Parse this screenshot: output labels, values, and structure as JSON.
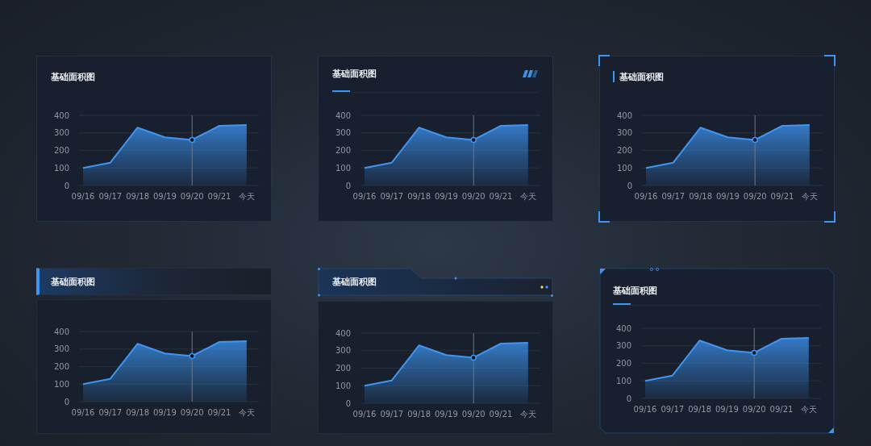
{
  "cards": [
    {
      "kind": "plain",
      "title": "基础面积图",
      "chart_data": {
        "type": "area",
        "categories": [
          "09/16",
          "09/17",
          "09/18",
          "09/19",
          "09/20",
          "09/21",
          "今天"
        ],
        "series": [
          {
            "color": "#3d96f5",
            "values": [
              100,
              130,
              330,
              275,
              260,
              340,
              345
            ]
          }
        ],
        "ylim": [
          0,
          400
        ],
        "yticks": [
          0,
          100,
          200,
          300,
          400
        ],
        "grid": true,
        "ref_lines": [
          {
            "axis": "x",
            "value": "09/20"
          }
        ]
      }
    },
    {
      "kind": "underline",
      "title": "基础面积图",
      "chart_data": {
        "type": "area",
        "categories": [
          "09/16",
          "09/17",
          "09/18",
          "09/19",
          "09/20",
          "09/21",
          "今天"
        ],
        "series": [
          {
            "color": "#3d96f5",
            "values": [
              100,
              130,
              330,
              275,
              260,
              340,
              345
            ]
          }
        ],
        "ylim": [
          0,
          400
        ],
        "yticks": [
          0,
          100,
          200,
          300,
          400
        ],
        "grid": true,
        "ref_lines": [
          {
            "axis": "x",
            "value": "09/20"
          }
        ]
      }
    },
    {
      "kind": "corners",
      "title": "基础面积图",
      "chart_data": {
        "type": "area",
        "categories": [
          "09/16",
          "09/17",
          "09/18",
          "09/19",
          "09/20",
          "09/21",
          "今天"
        ],
        "series": [
          {
            "color": "#3d96f5",
            "values": [
              100,
              130,
              330,
              275,
              260,
              340,
              345
            ]
          }
        ],
        "ylim": [
          0,
          400
        ],
        "yticks": [
          0,
          100,
          200,
          300,
          400
        ],
        "grid": true,
        "ref_lines": [
          {
            "axis": "x",
            "value": "09/20"
          }
        ]
      }
    },
    {
      "kind": "header-bar",
      "title": "基础面积图",
      "chart_data": {
        "type": "area",
        "categories": [
          "09/16",
          "09/17",
          "09/18",
          "09/19",
          "09/20",
          "09/21",
          "今天"
        ],
        "series": [
          {
            "color": "#3d96f5",
            "values": [
              100,
              130,
              330,
              275,
              260,
              340,
              345
            ]
          }
        ],
        "ylim": [
          0,
          400
        ],
        "yticks": [
          0,
          100,
          200,
          300,
          400
        ],
        "grid": true,
        "ref_lines": [
          {
            "axis": "x",
            "value": "09/20"
          }
        ]
      }
    },
    {
      "kind": "tab-header",
      "title": "基础面积图",
      "chart_data": {
        "type": "area",
        "categories": [
          "09/16",
          "09/17",
          "09/18",
          "09/19",
          "09/20",
          "09/21",
          "今天"
        ],
        "series": [
          {
            "color": "#3d96f5",
            "values": [
              100,
              130,
              330,
              275,
              260,
              340,
              345
            ]
          }
        ],
        "ylim": [
          0,
          400
        ],
        "yticks": [
          0,
          100,
          200,
          300,
          400
        ],
        "grid": true,
        "ref_lines": [
          {
            "axis": "x",
            "value": "09/20"
          }
        ]
      }
    },
    {
      "kind": "tech-frame",
      "title": "基础面积图",
      "chart_data": {
        "type": "area",
        "categories": [
          "09/16",
          "09/17",
          "09/18",
          "09/19",
          "09/20",
          "09/21",
          "今天"
        ],
        "series": [
          {
            "color": "#3d96f5",
            "values": [
              100,
              130,
              330,
              275,
              260,
              340,
              345
            ]
          }
        ],
        "ylim": [
          0,
          400
        ],
        "yticks": [
          0,
          100,
          200,
          300,
          400
        ],
        "grid": true,
        "ref_lines": [
          {
            "axis": "x",
            "value": "09/20"
          }
        ]
      }
    }
  ]
}
